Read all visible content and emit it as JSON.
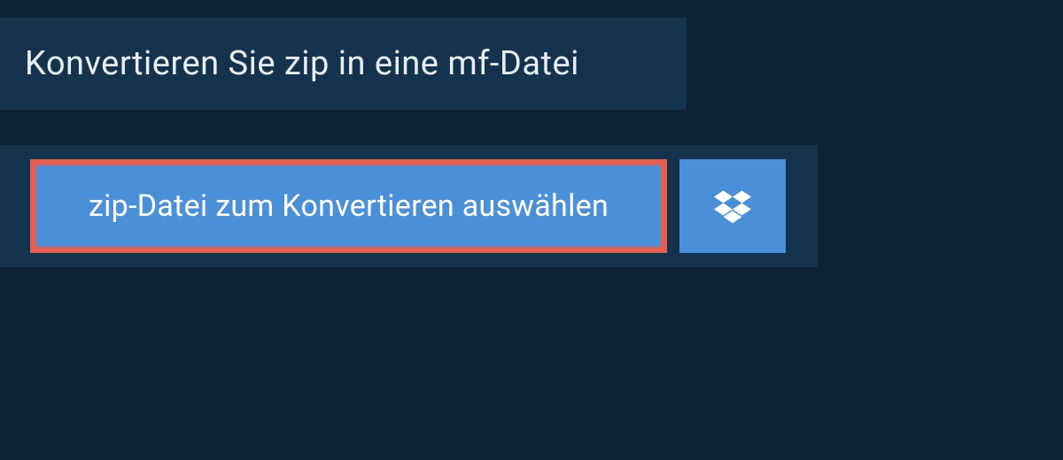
{
  "header": {
    "title": "Konvertieren Sie zip in eine mf-Datei"
  },
  "actions": {
    "select_file_label": "zip-Datei zum Konvertieren auswählen"
  },
  "colors": {
    "background": "#0d2438",
    "panel": "#16334d",
    "button": "#4a90d9",
    "highlight_border": "#e85d52",
    "text_light": "#ffffff"
  }
}
